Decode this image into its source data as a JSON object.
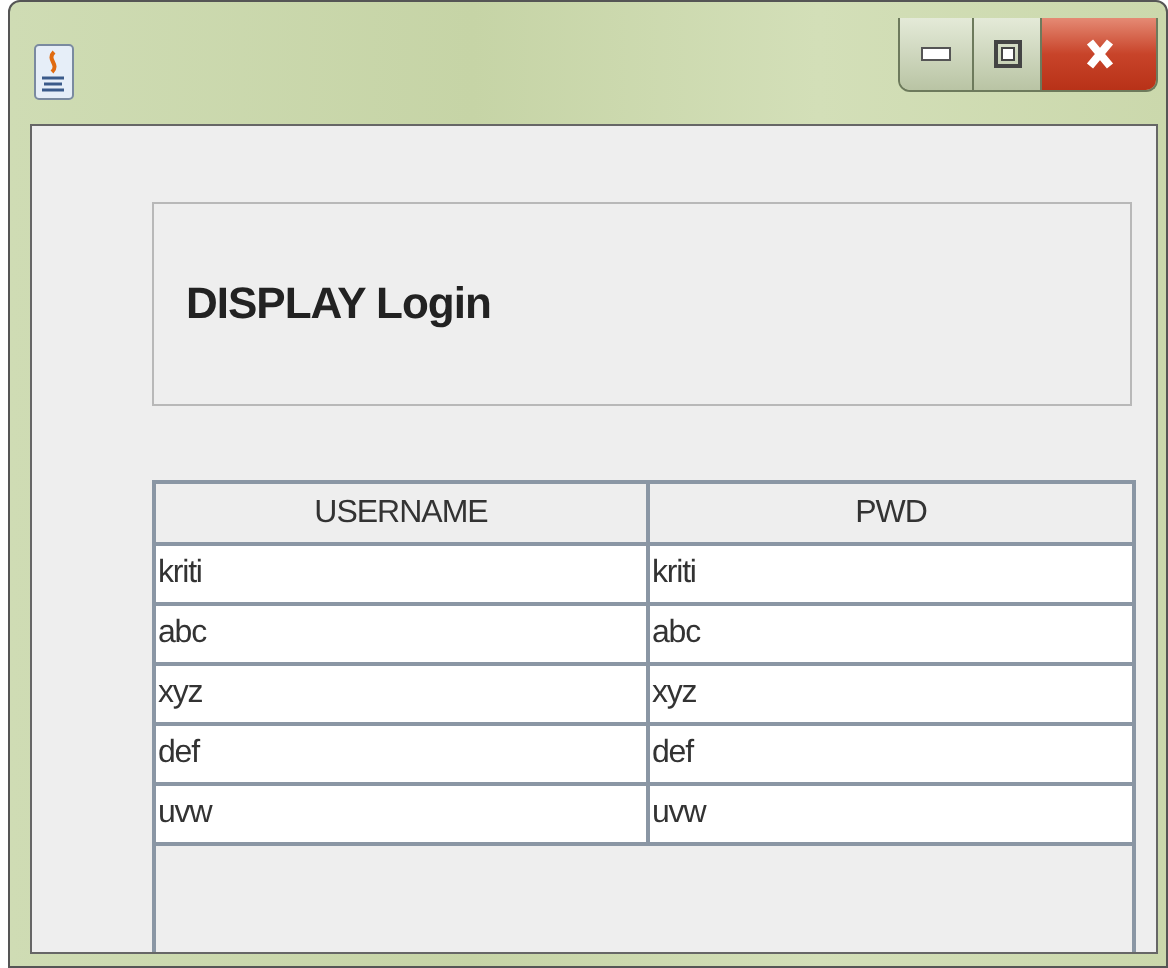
{
  "window": {
    "controls": [
      {
        "kind": "minimize"
      },
      {
        "kind": "maximize"
      },
      {
        "kind": "close"
      }
    ]
  },
  "heading": "DISPLAY Login",
  "table": {
    "columns": [
      "USERNAME",
      "PWD"
    ],
    "rows": [
      [
        "kriti",
        "kriti"
      ],
      [
        "abc",
        "abc"
      ],
      [
        "xyz",
        "xyz"
      ],
      [
        "def",
        "def"
      ],
      [
        "uvw",
        "uvw"
      ]
    ]
  }
}
